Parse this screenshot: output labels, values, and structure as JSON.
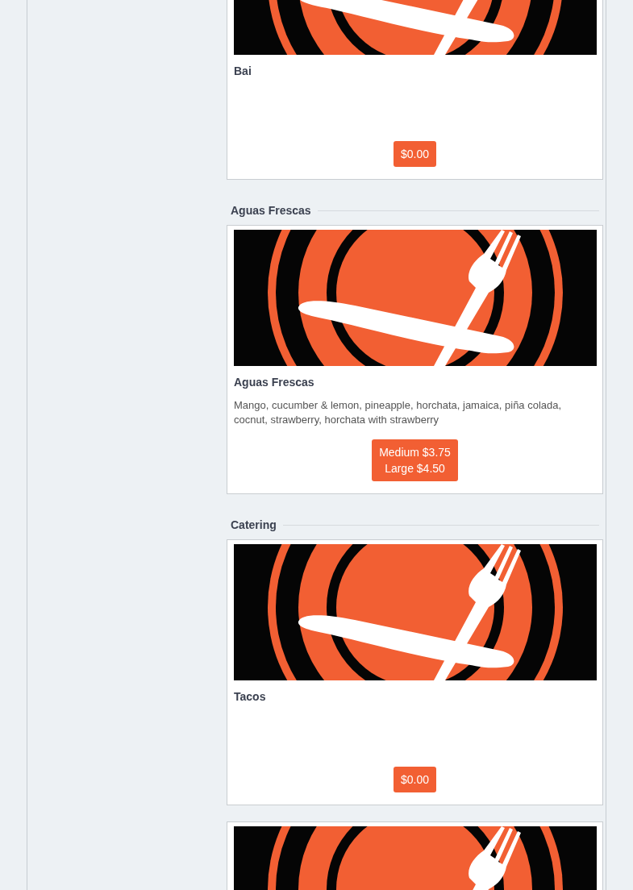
{
  "sections": [
    {
      "items": [
        {
          "kind": "dish",
          "name": "Bai",
          "prices": [
            "$0.00"
          ]
        }
      ]
    },
    {
      "heading": "Aguas Frescas",
      "items": [
        {
          "kind": "dish",
          "name": "Aguas Frescas",
          "description": "Mango, cucumber & lemon, pineapple, horchata, jamaica, piña colada, cocnut, strawberry, horchata with strawberry",
          "prices": [
            "Medium $3.75",
            "Large $4.50"
          ]
        }
      ]
    },
    {
      "heading": "Catering",
      "items": [
        {
          "kind": "dish",
          "name": "Tacos",
          "prices": [
            "$0.00"
          ]
        },
        {
          "kind": "picture"
        }
      ]
    }
  ]
}
